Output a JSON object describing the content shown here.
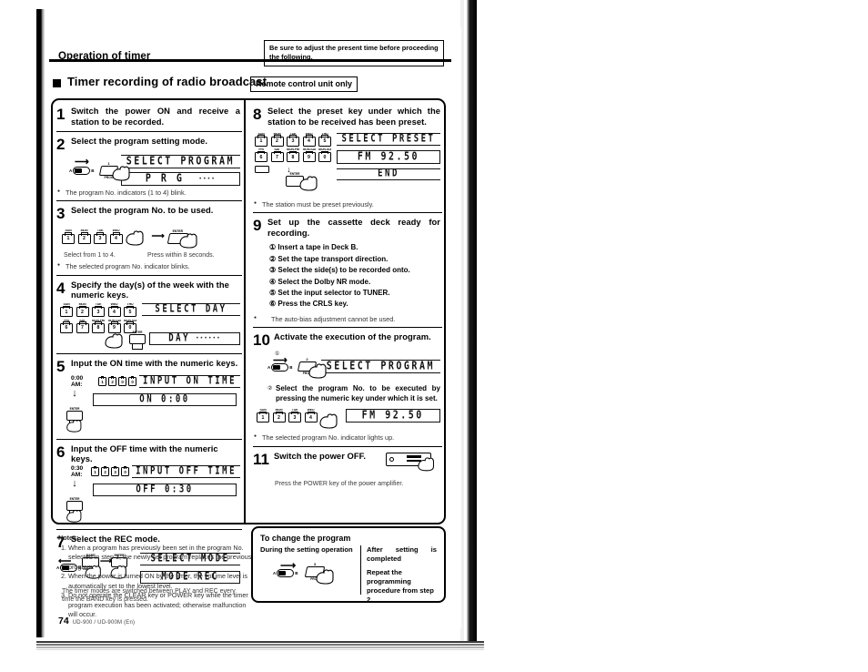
{
  "header": {
    "title": "Operation of timer",
    "note": "Be sure to adjust the present time before proceeding the following."
  },
  "section": {
    "title": "Timer recording of radio broadcast",
    "badge": "Remote control unit only"
  },
  "steps_left": [
    {
      "num": "1",
      "text": "Switch the power ON and receive a station to be recorded."
    },
    {
      "num": "2",
      "text": "Select the program setting mode.",
      "lcd1": "SELECT PROGRAM",
      "lcd2": "P R G",
      "bullet": "The program No. indicators (1 to 4) blink.",
      "key_label": "PROG",
      "switch_a": "A",
      "switch_b": "B"
    },
    {
      "num": "3",
      "text": "Select the program No. to be used.",
      "keys": [
        {
          "cap": "SUN",
          "num": "1"
        },
        {
          "cap": "MON",
          "num": "2"
        },
        {
          "cap": "TUE",
          "num": "3"
        },
        {
          "cap": "WED",
          "num": "4"
        }
      ],
      "enter_label": "ENTER",
      "note_left": "Select from 1 to 4.",
      "note_right": "Press within 8 seconds.",
      "bullet": "The selected program No. indicator blinks."
    },
    {
      "num": "4",
      "text": "Specify the day(s) of the week with the numeric keys.",
      "lcd1": "SELECT DAY",
      "lcd2": "DAY",
      "enter_label": "ENTER",
      "keys_row1": [
        {
          "cap": "SUN",
          "num": "1"
        },
        {
          "cap": "MON",
          "num": "2"
        },
        {
          "cap": "TUE",
          "num": "3"
        },
        {
          "cap": "WED",
          "num": "4"
        },
        {
          "cap": "THU",
          "num": "5"
        }
      ],
      "keys_row2": [
        {
          "cap": "FRI",
          "num": "6"
        },
        {
          "cap": "SAT",
          "num": "7"
        },
        {
          "cap": "MON-FRI",
          "num": "8"
        },
        {
          "cap": "MON-SAT",
          "num": "9"
        },
        {
          "cap": "MON-SUN",
          "num": "0"
        }
      ]
    },
    {
      "num": "5",
      "text": "Input the ON time with the numeric keys.",
      "time_label": "0:00 AM:",
      "time_keys": [
        "1",
        "2",
        "0",
        "0"
      ],
      "lcd1": "INPUT ON TIME",
      "lcd2": "ON  0:00",
      "enter_label": "ENTER"
    },
    {
      "num": "6",
      "text": "Input the OFF time with the numeric keys.",
      "time_label": "0:30 AM:",
      "time_keys": [
        "1",
        "2",
        "3",
        "0"
      ],
      "lcd1": "INPUT OFF TIME",
      "lcd2": "OFF  0:30",
      "enter_label": "ENTER"
    },
    {
      "num": "7",
      "text": "Select the REC mode.",
      "lcd1": "SELECT MODE",
      "lcd2": "MODE REC",
      "band_label": "BAND",
      "band_sub": "TIMER MODE",
      "enter_label": "ENTER",
      "note": "The timer modes are switched between PLAY and REC every time the BAND key is pressed.",
      "note_key": "BAND",
      "switch_a": "A",
      "switch_b": "B"
    }
  ],
  "steps_right": [
    {
      "num": "8",
      "text": "Select the preset key under which the station to be received has been preset.",
      "lcd1": "SELECT PRESET",
      "lcd2": "FM  92.50",
      "lcd3": "END",
      "enter_label": "ENTER",
      "keys_row1": [
        {
          "cap": "SUN",
          "num": "1"
        },
        {
          "cap": "MON",
          "num": "2"
        },
        {
          "cap": "TUE",
          "num": "3"
        },
        {
          "cap": "WED",
          "num": "4"
        },
        {
          "cap": "THU",
          "num": "5"
        }
      ],
      "keys_row2": [
        {
          "cap": "FRI",
          "num": "6"
        },
        {
          "cap": "SAT",
          "num": "7"
        },
        {
          "cap": "MON-FRI",
          "num": "8"
        },
        {
          "cap": "MON-SAT",
          "num": "9"
        },
        {
          "cap": "MON-SUN",
          "num": "0"
        }
      ],
      "bullet": "The station must be preset previously."
    },
    {
      "num": "9",
      "text": "Set up the cassette deck ready for recording.",
      "items": [
        "Insert a tape in Deck B.",
        "Set the tape transport direction.",
        "Select the side(s) to be recorded onto.",
        "Select the Dolby NR mode.",
        "Set the input selector to TUNER.",
        "Press the CRLS key."
      ],
      "bullet": "The auto-bias adjustment cannot be used."
    },
    {
      "num": "10",
      "text": "Activate the execution of the program.",
      "sub1": "",
      "sub2": "Select the program No. to be executed by pressing the numeric key under which it is set.",
      "lcd1": "SELECT PROGRAM",
      "lcd2": "FM  92.50",
      "key_label": "PROG",
      "keys": [
        {
          "cap": "SUN",
          "num": "1"
        },
        {
          "cap": "MON",
          "num": "2"
        },
        {
          "cap": "TUE",
          "num": "3"
        },
        {
          "cap": "WED",
          "num": "4"
        }
      ],
      "bullet": "The selected program No. indicator lights up.",
      "switch_a": "A",
      "switch_b": "B"
    },
    {
      "num": "11",
      "text": "Switch the power OFF.",
      "note": "Press the POWER key of the power amplifier.",
      "note_key": "POWER"
    }
  ],
  "notes": {
    "title": "Notes:",
    "items": [
      "When a program has previously been set in the program No. selected in step 3, the newly-set program replaces the previous program.",
      "When the power is turned ON by the timer, the volume level is automatically set to the lowest level.",
      "Do not operate the CLEAR key or POWER key while the timer program execution has been activated; otherwise malfunction will occur."
    ],
    "key1": "CLEAR",
    "key2": "POWER"
  },
  "change_box": {
    "title": "To change the program",
    "left_head": "During the setting operation",
    "right_head": "After setting is completed",
    "right_body": "Repeat the programming procedure from step 2.",
    "key_label": "PROG",
    "switch_a": "A",
    "switch_b": "B"
  },
  "footer": {
    "page": "74",
    "model": "UD-900 / UD-900M (En)"
  }
}
